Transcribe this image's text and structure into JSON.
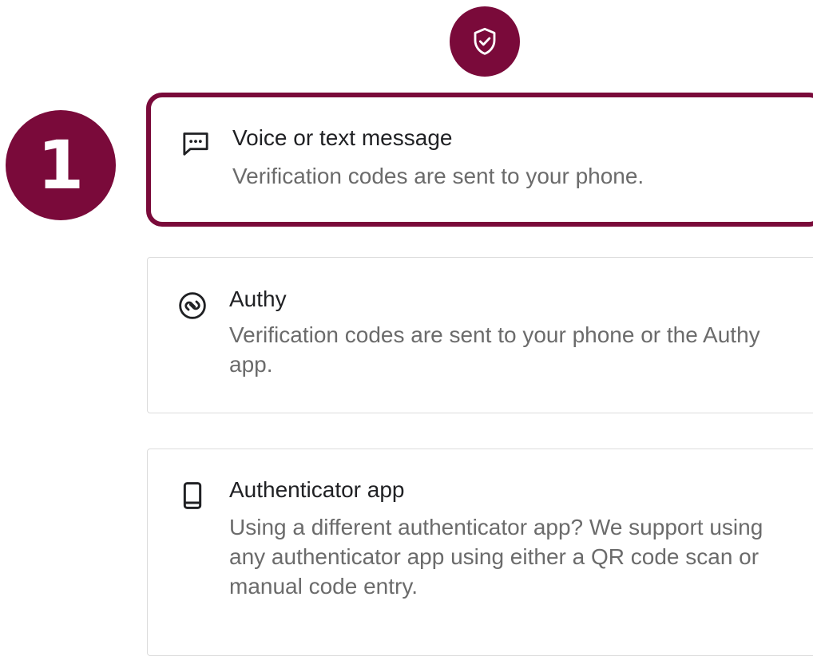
{
  "colors": {
    "accent": "#7a0a3a",
    "card_border": "#dcdcdc",
    "title_text": "#202124",
    "description_text": "#6b6b6b"
  },
  "header": {
    "icon": "shield-check-icon"
  },
  "step_marker": {
    "number": "1"
  },
  "options": [
    {
      "icon": "message-icon",
      "title": "Voice or text message",
      "description": "Verification codes are sent to your phone.",
      "highlighted": true
    },
    {
      "icon": "authy-icon",
      "title": "Authy",
      "description": "Verification codes are sent to your phone or the Authy app.",
      "highlighted": false
    },
    {
      "icon": "phone-icon",
      "title": "Authenticator app",
      "description": "Using a different authenticator app? We support using any authenticator app using either a QR code scan or manual code entry.",
      "highlighted": false
    }
  ]
}
